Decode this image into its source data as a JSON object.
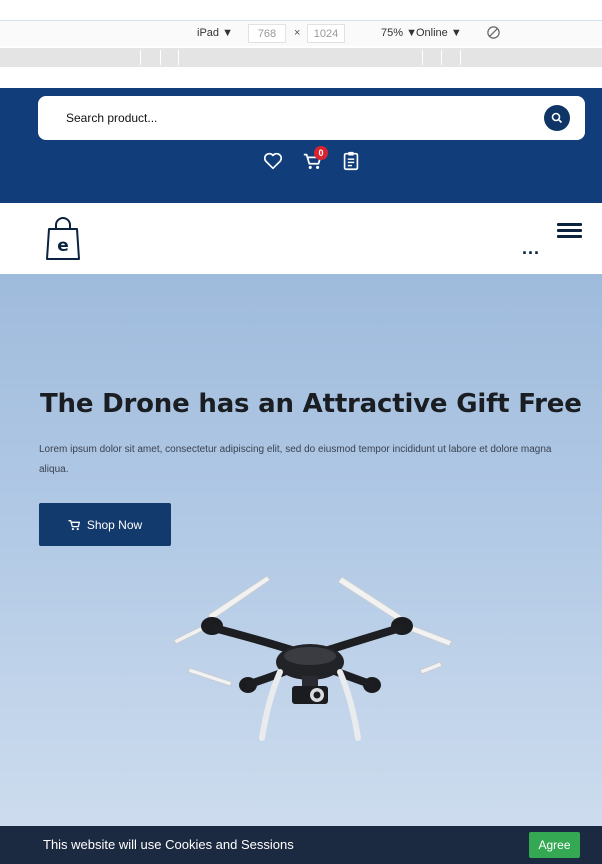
{
  "devtools": {
    "device": "iPad ▼",
    "width": "768",
    "times": "×",
    "height": "1024",
    "zoom": "75% ▼",
    "network": "Online ▼"
  },
  "header": {
    "search_placeholder": "Search product...",
    "cart_count": "0",
    "colors": {
      "bg": "#113e7b",
      "badge": "#d9232d"
    },
    "icons": [
      "heart-icon",
      "cart-icon",
      "clipboard-icon"
    ]
  },
  "nav": {
    "more_label": "...",
    "logo_letter": "e"
  },
  "hero": {
    "title": "The Drone has an Attractive Gift Free",
    "text": "Lorem ipsum dolor sit amet, consectetur adipiscing elit, sed do eiusmod tempor incididunt ut labore et dolore magna aliqua.",
    "button_label": "Shop Now"
  },
  "cookie": {
    "message": "This website will use Cookies and Sessions",
    "agree_label": "Agree",
    "colors": {
      "bar": "#1c2a41",
      "button": "#34a853"
    }
  }
}
